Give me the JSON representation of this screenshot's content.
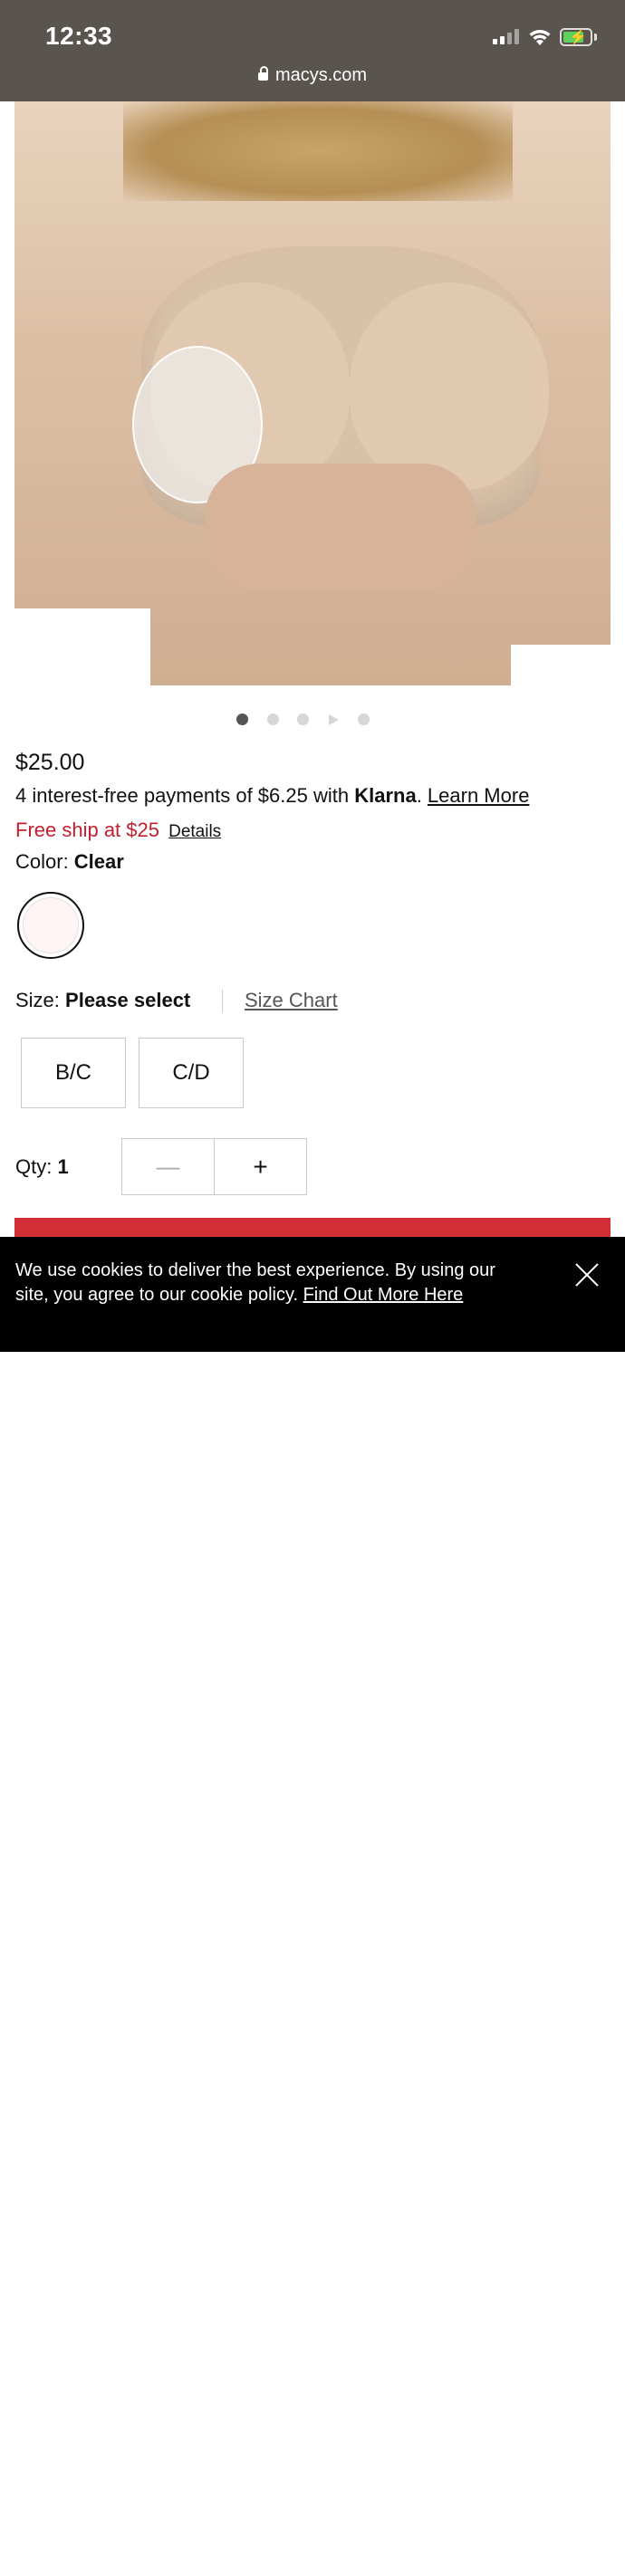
{
  "status_bar": {
    "time": "12:33",
    "url": "macys.com"
  },
  "product": {
    "image_alt_icon": "product-photo",
    "carousel": {
      "dot_count": 4,
      "has_video": true,
      "active_index": 0
    },
    "price": "$25.00",
    "klarna": {
      "prefix": "4 interest-free payments of $6.25 with ",
      "brand": "Klarna",
      "suffix": ". ",
      "learn_more": "Learn More"
    },
    "shipping": {
      "text": "Free ship at $25",
      "details": "Details",
      "color": "#c21f2f"
    },
    "color": {
      "label": "Color: ",
      "value": "Clear",
      "swatch_color": "#fff5f4"
    },
    "size": {
      "label": "Size: ",
      "value": "Please select",
      "chart_link": "Size Chart",
      "options": [
        "B/C",
        "C/D"
      ]
    },
    "quantity": {
      "label": "Qty: ",
      "value": "1",
      "minus": "—",
      "plus": "+"
    },
    "add_to_bag_color": "#d12e36"
  },
  "cookie_banner": {
    "text": "We use cookies to deliver the best experience. By using our site, you agree to our cookie policy. ",
    "link": "Find Out More Here"
  }
}
